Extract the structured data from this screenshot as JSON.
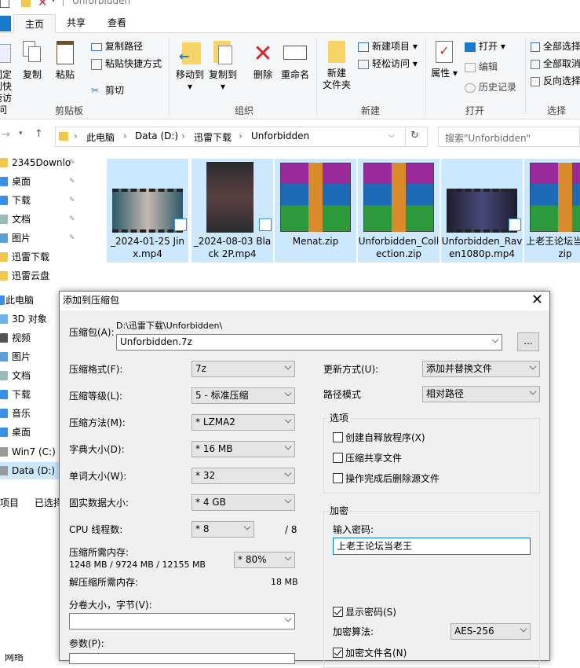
{
  "window": {
    "title": "Unforbidden"
  },
  "ribbon_tabs": [
    "主页",
    "共享",
    "查看"
  ],
  "ribbon": {
    "pin_quick": "固定到快\n速访问",
    "copy": "复制",
    "paste": "粘贴",
    "copy_path": "复制路径",
    "paste_shortcut": "粘贴快捷方式",
    "cut": "剪切",
    "group_clipboard": "剪贴板",
    "move_to": "移动到",
    "copy_to": "复制到",
    "delete": "删除",
    "rename": "重命名",
    "group_organize": "组织",
    "new_folder": "新建\n文件夹",
    "new_item": "新建项目",
    "easy_access": "轻松访问",
    "group_new": "新建",
    "properties": "属性",
    "open": "打开",
    "edit": "编辑",
    "history": "历史记录",
    "group_open": "打开",
    "select_all": "全部选择",
    "select_none": "全部取消",
    "invert_selection": "反向选择",
    "group_select": "选择"
  },
  "address": {
    "crumbs": [
      "此电脑",
      "Data (D:)",
      "迅雷下载",
      "Unforbidden"
    ],
    "search_placeholder": "搜索\"Unforbidden\""
  },
  "nav": {
    "items": [
      {
        "label": "2345Downlo",
        "pinned": true
      },
      {
        "label": "桌面",
        "pinned": true
      },
      {
        "label": "下载",
        "pinned": true
      },
      {
        "label": "文档",
        "pinned": true
      },
      {
        "label": "图片",
        "pinned": true
      },
      {
        "label": "迅雷下载",
        "pinned": false
      },
      {
        "label": "迅雷云盘",
        "pinned": false
      }
    ],
    "this_pc": "此电脑",
    "pc_items": [
      "3D 对象",
      "视频",
      "图片",
      "文档",
      "下载",
      "音乐",
      "桌面",
      "Win7 (C:)",
      "Data (D:)"
    ],
    "network": "网络"
  },
  "files": [
    {
      "name": "_2024-01-25 Jinx.mp4",
      "type": "video"
    },
    {
      "name": "_2024-08-03 Black 2P.mp4",
      "type": "video"
    },
    {
      "name": "Menat.zip",
      "type": "archive"
    },
    {
      "name": "Unforbidden_Collection.zip",
      "type": "archive"
    },
    {
      "name": "Unforbidden_Raven1080p.mp4",
      "type": "video"
    },
    {
      "name": "上老王论坛当老王.zip",
      "type": "archive"
    }
  ],
  "status": {
    "items": "项目",
    "selected": "已选择"
  },
  "dialog": {
    "title": "添加到压缩包",
    "archive_label": "压缩包(A):",
    "archive_dir": "D:\\迅雷下载\\Unforbidden\\",
    "archive_name": "Unforbidden.7z",
    "browse": "...",
    "format_label": "压缩格式(F):",
    "format": "7z",
    "level_label": "压缩等级(L):",
    "level": "5 - 标准压缩",
    "method_label": "压缩方法(M):",
    "method": "* LZMA2",
    "dict_label": "字典大小(D):",
    "dict": "* 16 MB",
    "word_label": "单词大小(W):",
    "word": "* 32",
    "solid_label": "固实数据大小:",
    "solid": "* 4 GB",
    "threads_label": "CPU 线程数:",
    "threads": "* 8",
    "threads_max": "/ 8",
    "mem_label": "压缩所需内存:",
    "mem_values": "1248 MB / 9724 MB / 12155 MB",
    "mem_percent": "* 80%",
    "decomp_label": "解压缩所需内存:",
    "decomp_value": "18 MB",
    "split_label": "分卷大小，字节(V):",
    "params_label": "参数(P):",
    "update_label": "更新方式(U):",
    "update": "添加并替换文件",
    "path_label": "路径模式",
    "path_mode": "相对路径",
    "options_label": "选项",
    "opt_sfx": "创建自释放程序(X)",
    "opt_shared": "压缩共享文件",
    "opt_delete": "操作完成后删除源文件",
    "encrypt_label": "加密",
    "password_label": "输入密码:",
    "password": "上老王论坛当老王",
    "show_password": "显示密码(S)",
    "enc_method_label": "加密算法:",
    "enc_method": "AES-256",
    "encrypt_names": "加密文件名(N)"
  }
}
